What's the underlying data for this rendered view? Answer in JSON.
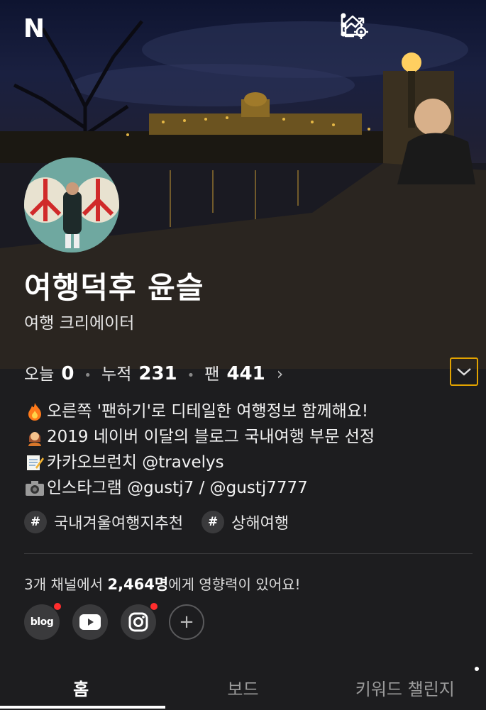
{
  "header": {
    "logo_letter": "N",
    "icons": [
      "home-settings-icon",
      "stats-chart-icon",
      "more-vertical-icon"
    ]
  },
  "profile": {
    "name": "여행덕후 윤슬",
    "subtitle": "여행 크리에이터"
  },
  "stats": {
    "today_label": "오늘",
    "today_value": "0",
    "total_label": "누적",
    "total_value": "231",
    "fans_label": "팬",
    "fans_value": "441"
  },
  "bio": [
    {
      "icon": "fire-emoji",
      "text": "오른쪽 '팬하기'로 디테일한 여행정보 함께해요!"
    },
    {
      "icon": "person-emoji",
      "text": "2019 네이버 이달의 블로그 국내여행 부문 선정"
    },
    {
      "icon": "memo-emoji",
      "text": "카카오브런치 @travelys"
    },
    {
      "icon": "camera-emoji",
      "text": "인스타그램 @gustj7 / @gustj7777"
    }
  ],
  "tags": [
    {
      "hash": "#",
      "label": "국내겨울여행지추천"
    },
    {
      "hash": "#",
      "label": "상해여행"
    }
  ],
  "influence": {
    "prefix": "3개 채널에서 ",
    "count": "2,464명",
    "suffix": "에게 영향력이 있어요!"
  },
  "channels": [
    {
      "name": "blog",
      "label": "blog",
      "new": true
    },
    {
      "name": "youtube",
      "new": false
    },
    {
      "name": "instagram",
      "new": true
    },
    {
      "name": "add",
      "label": "+",
      "new": false
    }
  ],
  "tabs": [
    {
      "label": "홈",
      "active": true
    },
    {
      "label": "보드",
      "active": false
    },
    {
      "label": "키워드 챌린지",
      "active": false
    }
  ],
  "colors": {
    "background": "#1d1d1f",
    "accent_focus": "#e2a300",
    "badge": "#ff2d2d"
  }
}
